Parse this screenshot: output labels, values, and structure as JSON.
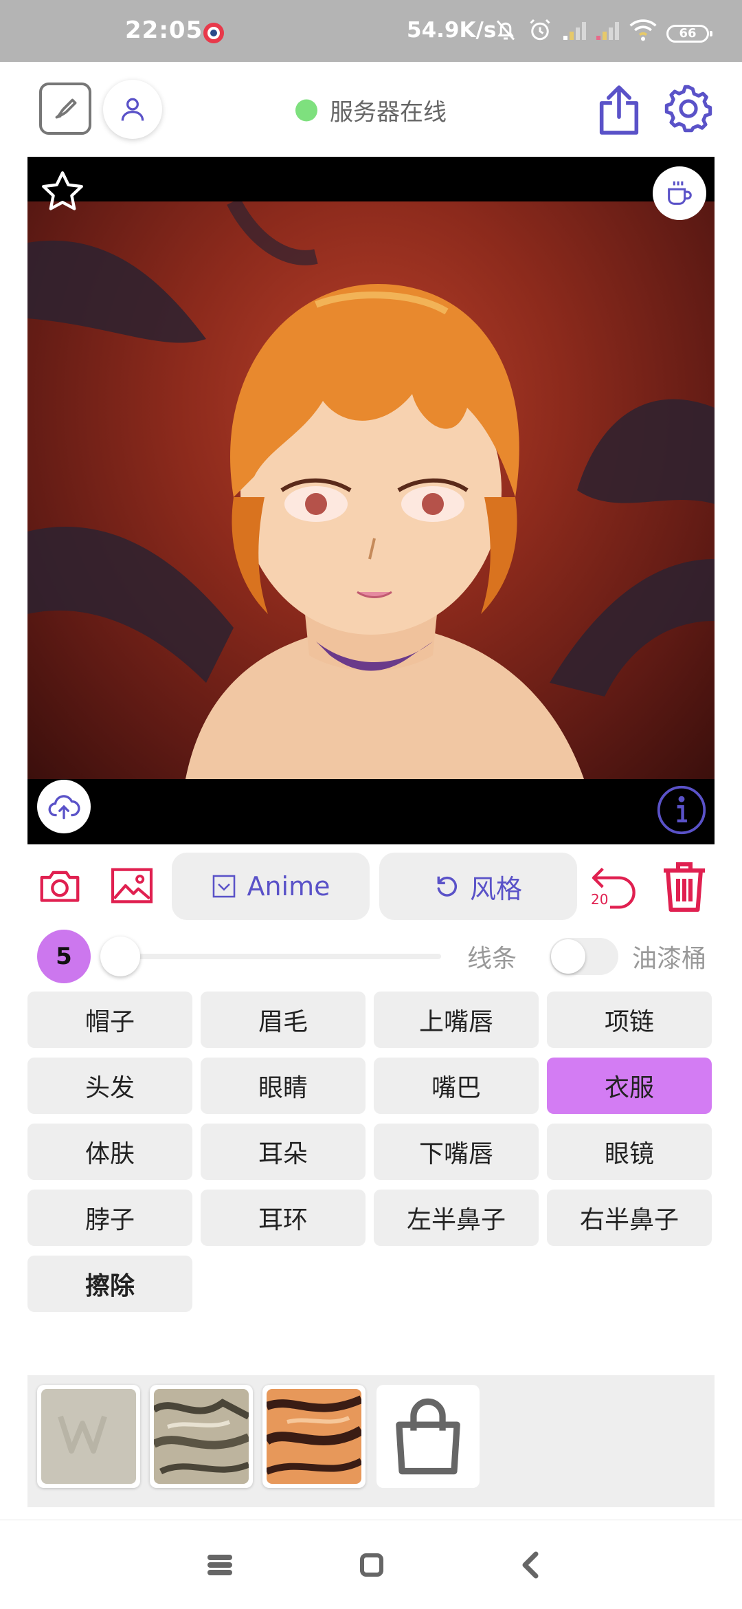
{
  "status_bar": {
    "time": "22:05",
    "net_speed": "54.9K/s",
    "battery": "66"
  },
  "header": {
    "server_status": "服务器在线",
    "server_status_color": "#7ee07e"
  },
  "toolbar": {
    "anime_label": "Anime",
    "style_label": "风格",
    "undo_count": "20",
    "accent_color": "#5a52c8",
    "danger_color": "#e02050"
  },
  "brush": {
    "size": "5",
    "slider_value": 0,
    "lines_label": "线条",
    "bucket_label": "油漆桶",
    "bucket_enabled": false
  },
  "segments": [
    {
      "label": "帽子"
    },
    {
      "label": "眉毛"
    },
    {
      "label": "上嘴唇"
    },
    {
      "label": "项链"
    },
    {
      "label": "头发"
    },
    {
      "label": "眼睛"
    },
    {
      "label": "嘴巴"
    },
    {
      "label": "衣服"
    },
    {
      "label": "体肤"
    },
    {
      "label": "耳朵"
    },
    {
      "label": "下嘴唇"
    },
    {
      "label": "眼镜"
    },
    {
      "label": "脖子"
    },
    {
      "label": "耳环"
    },
    {
      "label": "左半鼻子"
    },
    {
      "label": "右半鼻子"
    },
    {
      "label": "擦除"
    }
  ],
  "segments_selected": "衣服",
  "textures": [
    {
      "icon": "texture-watermark-icon"
    },
    {
      "icon": "texture-fur-gray-icon"
    },
    {
      "icon": "texture-fur-orange-icon"
    },
    {
      "icon": "shopping-bag-icon"
    }
  ]
}
